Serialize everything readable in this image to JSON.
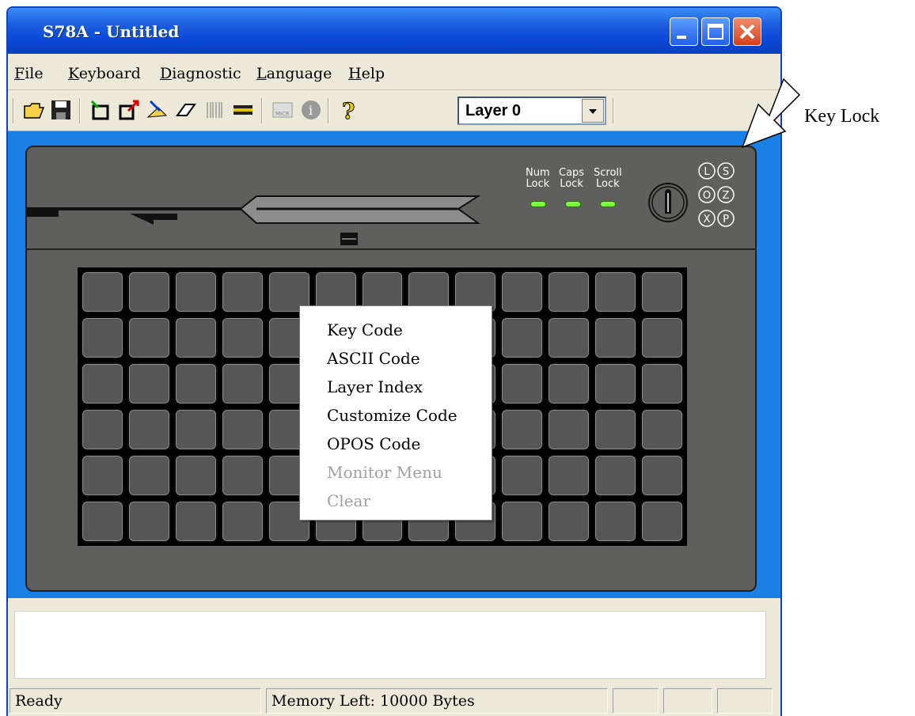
{
  "window": {
    "title": "S78A - Untitled"
  },
  "menu": [
    "File",
    "Keyboard",
    "Diagnostic",
    "Language",
    "Help"
  ],
  "toolbar": {
    "icons": [
      "open-icon",
      "save-icon",
      "new-layer-icon",
      "export-icon",
      "import-icon",
      "eraser-icon",
      "barcode-icon",
      "magstripe-icon",
      "micr-icon",
      "info-icon",
      "help-icon"
    ],
    "layer": "Layer 0"
  },
  "device": {
    "leds": [
      {
        "line1": "Num",
        "line2": "Lock"
      },
      {
        "line1": "Caps",
        "line2": "Lock"
      },
      {
        "line1": "Scroll",
        "line2": "Lock"
      }
    ],
    "keylock_positions": [
      "L",
      "S",
      "O",
      "Z",
      "X",
      "P"
    ]
  },
  "context_menu": {
    "items": [
      {
        "label": "Key Code",
        "enabled": true
      },
      {
        "label": "ASCII Code",
        "enabled": true
      },
      {
        "label": "Layer Index",
        "enabled": true
      },
      {
        "label": "Customize Code",
        "enabled": true
      },
      {
        "label": "OPOS Code",
        "enabled": true
      },
      {
        "label": "Monitor Menu",
        "enabled": false
      },
      {
        "label": "Clear",
        "enabled": false
      }
    ]
  },
  "status": {
    "ready": "Ready",
    "memory": "Memory Left:  10000 Bytes"
  },
  "annotation": {
    "label": "Key Lock"
  },
  "colors": {
    "workspace": "#1a80e6",
    "device_body": "#5f5f5d",
    "led": "#7dff3c"
  }
}
